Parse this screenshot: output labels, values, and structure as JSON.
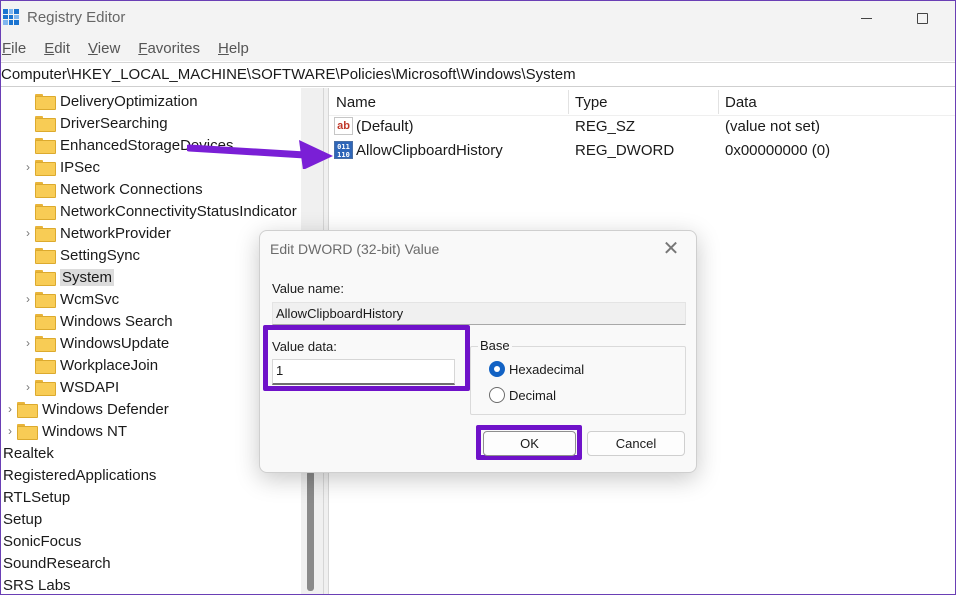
{
  "window": {
    "title": "Registry Editor"
  },
  "menu": [
    "File",
    "Edit",
    "View",
    "Favorites",
    "Help"
  ],
  "address": "Computer\\HKEY_LOCAL_MACHINE\\SOFTWARE\\Policies\\Microsoft\\Windows\\System",
  "tree": [
    {
      "label": "DeliveryOptimization",
      "level": 2,
      "expandable": false
    },
    {
      "label": "DriverSearching",
      "level": 2,
      "expandable": false
    },
    {
      "label": "EnhancedStorageDevices",
      "level": 2,
      "expandable": false
    },
    {
      "label": "IPSec",
      "level": 2,
      "expandable": true
    },
    {
      "label": "Network Connections",
      "level": 2,
      "expandable": false
    },
    {
      "label": "NetworkConnectivityStatusIndicator",
      "level": 2,
      "expandable": false
    },
    {
      "label": "NetworkProvider",
      "level": 2,
      "expandable": true
    },
    {
      "label": "SettingSync",
      "level": 2,
      "expandable": false
    },
    {
      "label": "System",
      "level": 2,
      "expandable": false,
      "selected": true
    },
    {
      "label": "WcmSvc",
      "level": 2,
      "expandable": true
    },
    {
      "label": "Windows Search",
      "level": 2,
      "expandable": false
    },
    {
      "label": "WindowsUpdate",
      "level": 2,
      "expandable": true
    },
    {
      "label": "WorkplaceJoin",
      "level": 2,
      "expandable": false
    },
    {
      "label": "WSDAPI",
      "level": 2,
      "expandable": true
    },
    {
      "label": "Windows Defender",
      "level": 1,
      "expandable": true
    },
    {
      "label": "Windows NT",
      "level": 1,
      "expandable": true
    },
    {
      "label": "Realtek",
      "level": 0,
      "expandable": false
    },
    {
      "label": "RegisteredApplications",
      "level": 0,
      "expandable": false
    },
    {
      "label": "RTLSetup",
      "level": 0,
      "expandable": false
    },
    {
      "label": "Setup",
      "level": 0,
      "expandable": false
    },
    {
      "label": "SonicFocus",
      "level": 0,
      "expandable": false
    },
    {
      "label": "SoundResearch",
      "level": 0,
      "expandable": false
    },
    {
      "label": "SRS Labs",
      "level": 0,
      "expandable": false
    }
  ],
  "list": {
    "columns": [
      "Name",
      "Type",
      "Data"
    ],
    "rows": [
      {
        "icon": "string-value-icon",
        "icon_text": "ab",
        "name": "(Default)",
        "type": "REG_SZ",
        "data": "(value not set)"
      },
      {
        "icon": "binary-value-icon",
        "icon_text": "011 110",
        "name": "AllowClipboardHistory",
        "type": "REG_DWORD",
        "data": "0x00000000 (0)"
      }
    ]
  },
  "dialog": {
    "title": "Edit DWORD (32-bit) Value",
    "value_name_label": "Value name:",
    "value_name": "AllowClipboardHistory",
    "value_data_label": "Value data:",
    "value_data": "1",
    "base_label": "Base",
    "base_options": [
      {
        "label": "Hexadecimal",
        "checked": true
      },
      {
        "label": "Decimal",
        "checked": false
      }
    ],
    "ok_label": "OK",
    "cancel_label": "Cancel"
  },
  "colors": {
    "highlight": "#6f12c9",
    "arrow": "#7a1fd6",
    "selection": "#dcdcdc"
  }
}
